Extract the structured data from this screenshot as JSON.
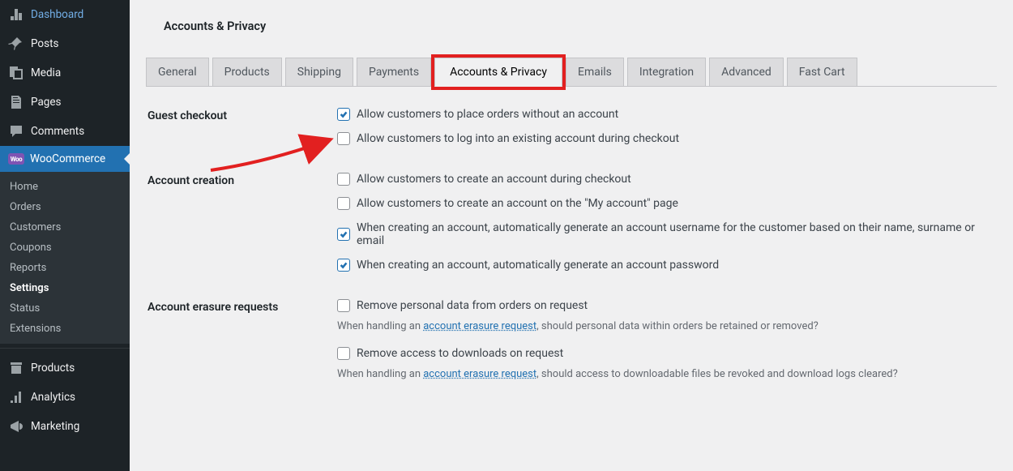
{
  "page": {
    "title": "Accounts & Privacy"
  },
  "sidebar": {
    "items": [
      {
        "label": "Dashboard",
        "icon": "dashboard"
      },
      {
        "label": "Posts",
        "icon": "pin"
      },
      {
        "label": "Media",
        "icon": "media"
      },
      {
        "label": "Pages",
        "icon": "pages"
      },
      {
        "label": "Comments",
        "icon": "comment"
      },
      {
        "label": "WooCommerce",
        "icon": "woo",
        "active": true
      },
      {
        "label": "Products",
        "icon": "archive"
      },
      {
        "label": "Analytics",
        "icon": "chart"
      },
      {
        "label": "Marketing",
        "icon": "megaphone"
      }
    ],
    "submenu": [
      {
        "label": "Home"
      },
      {
        "label": "Orders"
      },
      {
        "label": "Customers"
      },
      {
        "label": "Coupons"
      },
      {
        "label": "Reports"
      },
      {
        "label": "Settings",
        "current": true
      },
      {
        "label": "Status"
      },
      {
        "label": "Extensions"
      }
    ]
  },
  "tabs": [
    {
      "label": "General"
    },
    {
      "label": "Products"
    },
    {
      "label": "Shipping"
    },
    {
      "label": "Payments"
    },
    {
      "label": "Accounts & Privacy",
      "active": true,
      "highlight": true
    },
    {
      "label": "Emails"
    },
    {
      "label": "Integration"
    },
    {
      "label": "Advanced"
    },
    {
      "label": "Fast Cart"
    }
  ],
  "sections": {
    "guest_checkout": {
      "label": "Guest checkout",
      "opts": [
        {
          "label": "Allow customers to place orders without an account",
          "checked": true
        },
        {
          "label": "Allow customers to log into an existing account during checkout",
          "checked": false
        }
      ]
    },
    "account_creation": {
      "label": "Account creation",
      "opts": [
        {
          "label": "Allow customers to create an account during checkout",
          "checked": false
        },
        {
          "label": "Allow customers to create an account on the \"My account\" page",
          "checked": false
        },
        {
          "label": "When creating an account, automatically generate an account username for the customer based on their name, surname or email",
          "checked": true
        },
        {
          "label": "When creating an account, automatically generate an account password",
          "checked": true
        }
      ]
    },
    "erasure": {
      "label": "Account erasure requests",
      "opts": [
        {
          "label": "Remove personal data from orders on request",
          "checked": false
        },
        {
          "label": "Remove access to downloads on request",
          "checked": false
        }
      ],
      "desc1_pre": "When handling an ",
      "desc1_link": "account erasure request",
      "desc1_post": ", should personal data within orders be retained or removed?",
      "desc2_pre": "When handling an ",
      "desc2_link": "account erasure request",
      "desc2_post": ", should access to downloadable files be revoked and download logs cleared?"
    }
  }
}
